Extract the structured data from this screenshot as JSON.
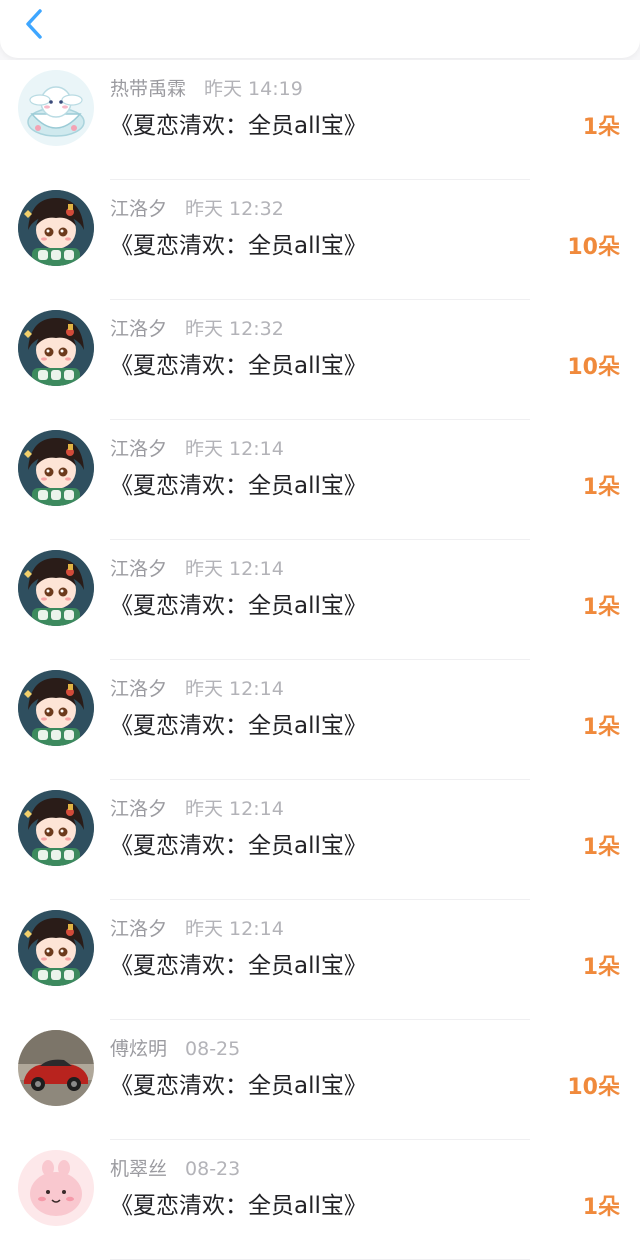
{
  "header": {
    "back_icon": "chevron-left-icon",
    "accent": "#3ea6ff"
  },
  "colors": {
    "amount": "#f08a3c",
    "title": "#222226",
    "meta": "#9b9ba0"
  },
  "items": [
    {
      "name": "热带禹霖",
      "time": "昨天 14:19",
      "title": "《夏恋清欢：全员all宝》",
      "amount": "1朵",
      "avatar": "cinnamoroll-cup-avatar"
    },
    {
      "name": "江洛夕",
      "time": "昨天 12:32",
      "title": "《夏恋清欢：全员all宝》",
      "amount": "10朵",
      "avatar": "anime-girl-avatar"
    },
    {
      "name": "江洛夕",
      "time": "昨天 12:32",
      "title": "《夏恋清欢：全员all宝》",
      "amount": "10朵",
      "avatar": "anime-girl-avatar"
    },
    {
      "name": "江洛夕",
      "time": "昨天 12:14",
      "title": "《夏恋清欢：全员all宝》",
      "amount": "1朵",
      "avatar": "anime-girl-avatar"
    },
    {
      "name": "江洛夕",
      "time": "昨天 12:14",
      "title": "《夏恋清欢：全员all宝》",
      "amount": "1朵",
      "avatar": "anime-girl-avatar"
    },
    {
      "name": "江洛夕",
      "time": "昨天 12:14",
      "title": "《夏恋清欢：全员all宝》",
      "amount": "1朵",
      "avatar": "anime-girl-avatar"
    },
    {
      "name": "江洛夕",
      "time": "昨天 12:14",
      "title": "《夏恋清欢：全员all宝》",
      "amount": "1朵",
      "avatar": "anime-girl-avatar"
    },
    {
      "name": "江洛夕",
      "time": "昨天 12:14",
      "title": "《夏恋清欢：全员all宝》",
      "amount": "1朵",
      "avatar": "anime-girl-avatar"
    },
    {
      "name": "傅炫明",
      "time": "08-25",
      "title": "《夏恋清欢：全员all宝》",
      "amount": "10朵",
      "avatar": "red-car-avatar"
    },
    {
      "name": "机翠丝",
      "time": "08-23",
      "title": "《夏恋清欢：全员all宝》",
      "amount": "1朵",
      "avatar": "pink-blob-avatar"
    }
  ]
}
